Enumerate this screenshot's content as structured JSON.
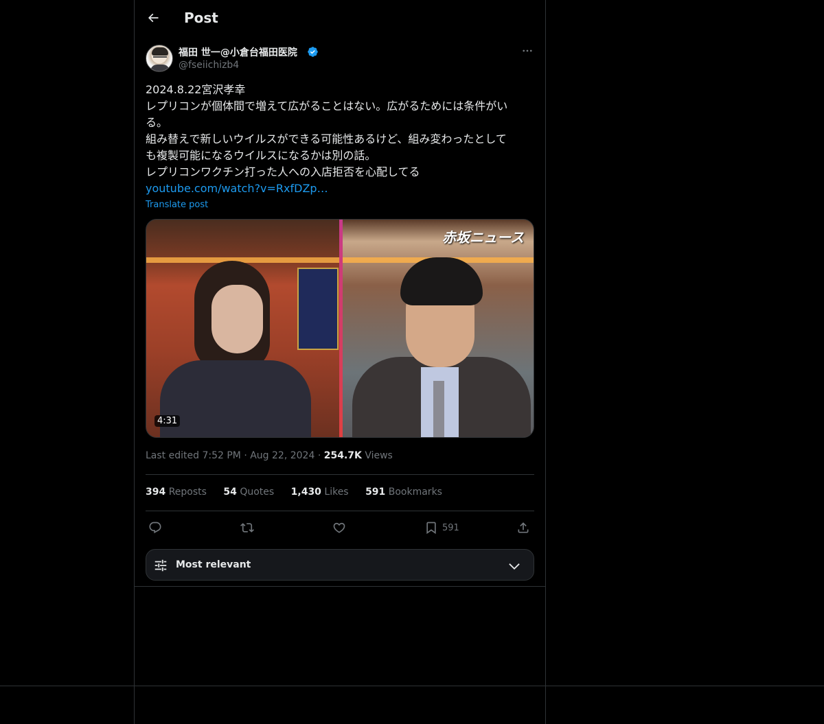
{
  "header": {
    "title": "Post"
  },
  "author": {
    "display_name": "福田 世一@小倉台福田医院",
    "handle": "@fseiichizb4"
  },
  "tweet": {
    "lines": [
      "2024.8.22宮沢孝幸",
      "レプリコンが個体間で増えて広がることはない。広がるためには条件がい",
      "る。",
      "組み替えで新しいウイルスができる可能性あるけど、組み変わったとして",
      "も複製可能になるウイルスになるかは別の話。",
      "レプリコンワクチン打った人への入店拒否を心配してる"
    ],
    "link": "youtube.com/watch?v=RxfDZp…",
    "translate": "Translate post"
  },
  "media": {
    "duration": "4:31",
    "logo_text": "赤坂ニュース"
  },
  "meta": {
    "edited": "Last edited 7:52 PM",
    "date": "Aug 22, 2024",
    "views_count": "254.7K",
    "views_label": "Views",
    "separator": "·"
  },
  "stats": {
    "reposts_count": "394",
    "reposts_label": "Reposts",
    "quotes_count": "54",
    "quotes_label": "Quotes",
    "likes_count": "1,430",
    "likes_label": "Likes",
    "bookmarks_count": "591",
    "bookmarks_label": "Bookmarks"
  },
  "actions": {
    "bookmark_count": "591"
  },
  "sort": {
    "label": "Most relevant"
  },
  "colors": {
    "accent": "#1d9bf0",
    "background": "#000000",
    "muted": "#71767b",
    "text": "#e7e9ea"
  },
  "icons": [
    "back-arrow-icon",
    "verified-badge-icon",
    "more-icon",
    "reply-icon",
    "repost-icon",
    "like-icon",
    "bookmark-icon",
    "share-icon",
    "sliders-icon",
    "chevron-down-icon"
  ]
}
